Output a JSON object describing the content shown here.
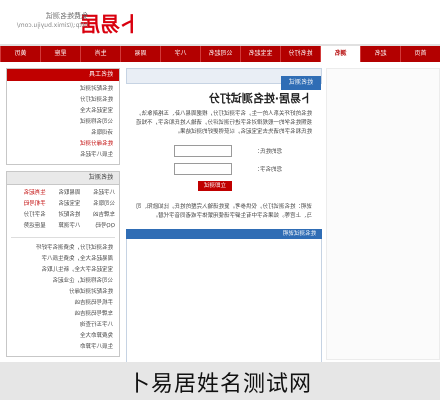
{
  "header": {
    "logo_text": "卜易居",
    "slogan": "免费姓名测试",
    "url": "http://zimix.buyiju.com/"
  },
  "nav": {
    "items": [
      "首页",
      "起名",
      "测名",
      "姓名打分",
      "宝宝起名",
      "公司起名",
      "八字",
      "周易",
      "生肖",
      "星座",
      "黄历"
    ],
    "active_index": 2
  },
  "sidebar": {
    "box1": {
      "title": "姓名工具",
      "items": [
        "姓名配对测试",
        "姓名测试打分",
        "宝宝起名大全",
        "公司名称测试",
        "诗词取名",
        "姓名缘分测试",
        "生辰八字起名"
      ],
      "highlight_index": 5
    },
    "box2": {
      "title": "姓名测试",
      "cells": [
        "八字起名",
        "周易取名",
        "生肖起名",
        "公司取名",
        "宝宝起名",
        "手机号码",
        "车牌吉凶",
        "姓名配对",
        "名字打分",
        "QQ号码",
        "八字测算",
        "星座运势"
      ],
      "highlight_indices": [
        2,
        5
      ]
    },
    "links": [
      "姓名测试打分，免费测名字好坏",
      "周易起名大全，免费生辰八字",
      "宝宝起名字大全，新生儿取名",
      "公司名称测试，企业起名",
      "姓名配对测试缘分",
      "手机号码测吉凶",
      "车牌号码测吉凶",
      "八字五行查询",
      "免费算命大全",
      "生辰八字算命"
    ]
  },
  "main": {
    "tab_label": "姓名测试",
    "title": "卜易居·姓名测试打分",
    "intro": "姓名的好坏关系人的一生，名字测试打分，根据周易八卦、五格剖象法，按照姓名学的一般规律对名字进行测试评分，请输入姓氏和名字，不知道姓氏和名字的请先去宝宝起名，以获得更好的测试结果。",
    "form": {
      "surname_label": "您的姓氏：",
      "name_label": "您的名字：",
      "submit_label": "立即测试"
    },
    "notes": "说明：姓名测试打分，仅供参考。复姓请输入完整的姓氏，比如欧阳、司马、上官等。如果名字中有生僻字请使用繁体字或者同音字代替。",
    "section2_label": "姓名测试说明"
  },
  "footer": {
    "caption": "卜易居姓名测试网"
  }
}
